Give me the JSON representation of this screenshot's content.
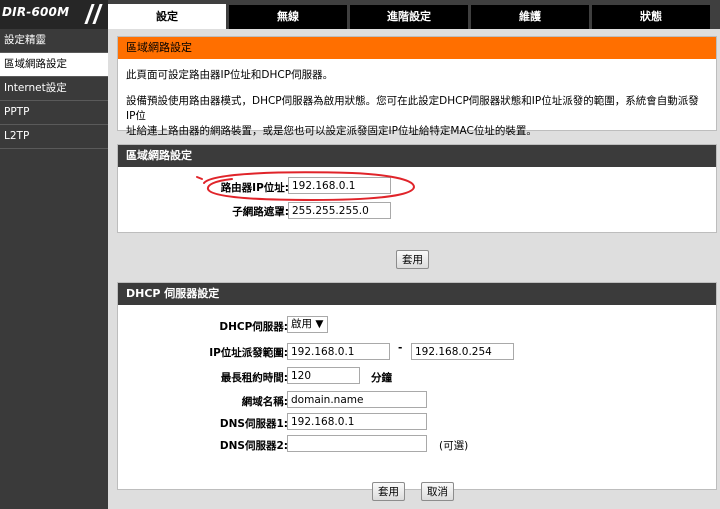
{
  "header": {
    "model": "DIR-600M",
    "tabs": [
      {
        "label": "設定"
      },
      {
        "label": "無線"
      },
      {
        "label": "進階設定"
      },
      {
        "label": "維護"
      },
      {
        "label": "狀態"
      }
    ]
  },
  "sidebar": {
    "items": [
      {
        "label": "設定精靈"
      },
      {
        "label": "區域網路設定"
      },
      {
        "label": "Internet設定"
      },
      {
        "label": "PPTP"
      },
      {
        "label": "L2TP"
      }
    ]
  },
  "intro": {
    "title": "區域網路設定",
    "line1": "此頁面可設定路由器IP位址和DHCP伺服器。",
    "line2": "設備預設使用路由器模式，DHCP伺服器為啟用狀態。您可在此設定DHCP伺服器狀態和IP位址派發的範圍，系統會自動派發IP位",
    "line3": "址給連上路由器的網路裝置，或是您也可以設定派發固定IP位址給特定MAC位址的裝置。"
  },
  "lan": {
    "title": "區域網路設定",
    "ip_label": "路由器IP位址:",
    "ip_value": "192.168.0.1",
    "mask_label": "子網路遮罩:",
    "mask_value": "255.255.255.0",
    "apply_label": "套用"
  },
  "dhcp": {
    "title": "DHCP 伺服器設定",
    "server_label": "DHCP伺服器:",
    "server_value": "啟用 ▼",
    "range_label": "IP位址派發範圍:",
    "range_start": "192.168.0.1",
    "range_sep": "-",
    "range_end": "192.168.0.254",
    "lease_label": "最長租約時間:",
    "lease_value": "120",
    "lease_unit": "分鐘",
    "domain_label": "網域名稱:",
    "domain_value": "domain.name",
    "dns1_label": "DNS伺服器1:",
    "dns1_value": "192.168.0.1",
    "dns2_label": "DNS伺服器2:",
    "dns2_value": "",
    "optional_label": "(可選)",
    "apply_label": "套用",
    "cancel_label": "取消"
  },
  "colors": {
    "accent_orange": "#ff6f00",
    "annotation_red": "#e0242a"
  }
}
